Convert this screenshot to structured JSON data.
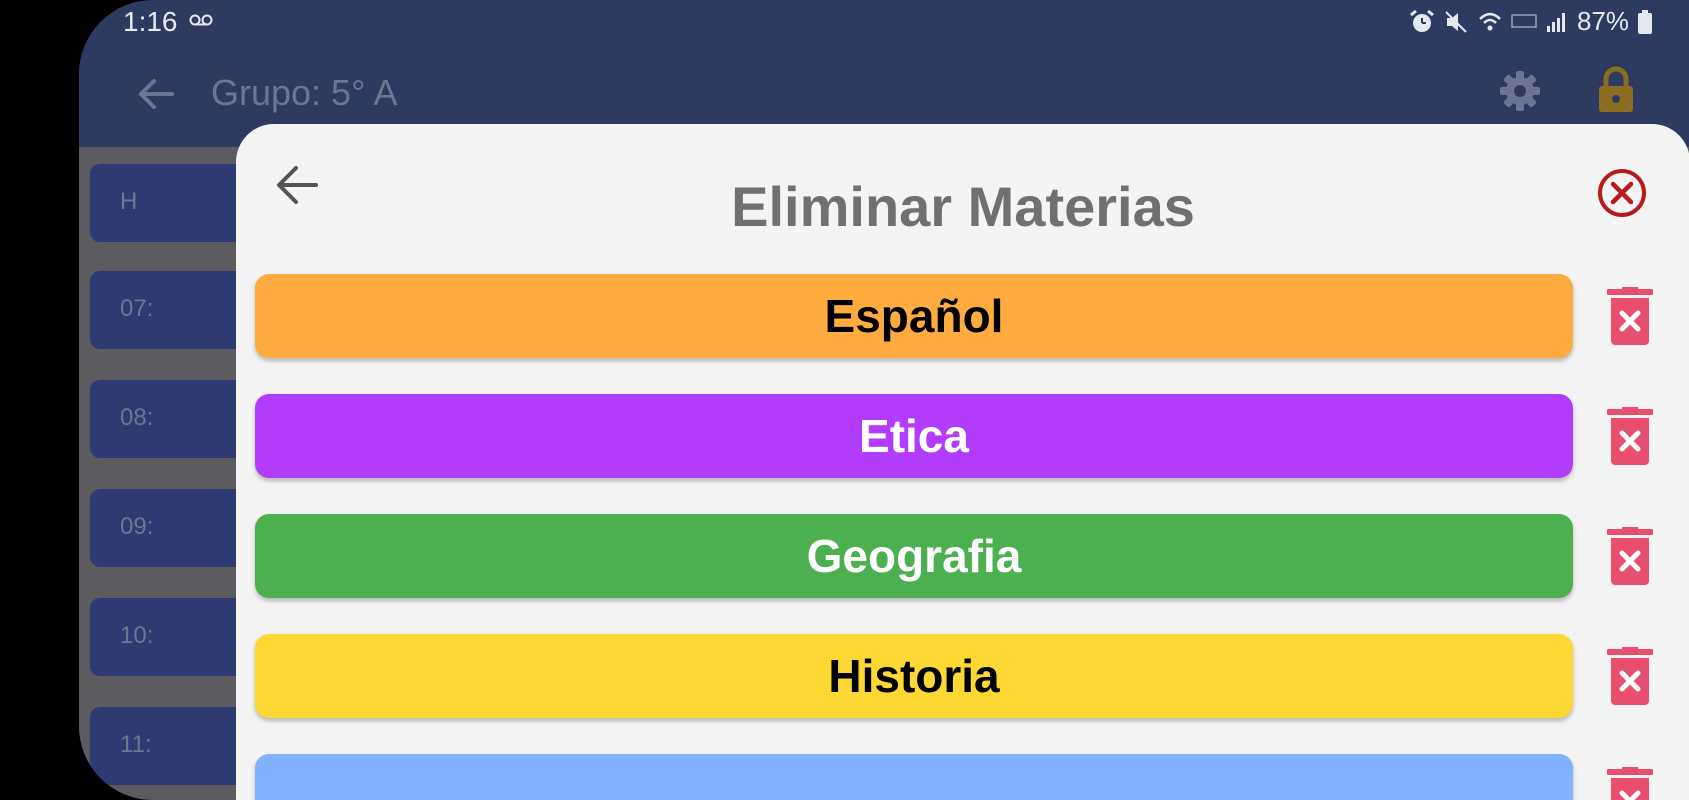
{
  "status": {
    "time": "1:16",
    "battery": "87%"
  },
  "appbar": {
    "title": "Grupo: 5° A"
  },
  "background_rows": [
    {
      "label": "H"
    },
    {
      "label": "07:"
    },
    {
      "label": "08:"
    },
    {
      "label": "09:"
    },
    {
      "label": "10:"
    },
    {
      "label": "11:"
    }
  ],
  "dialog": {
    "title": "Eliminar Materias",
    "subjects": [
      {
        "label": "Español",
        "color": "#ffab40",
        "text_color": "#000000"
      },
      {
        "label": "Etica",
        "color": "#b23cfb",
        "text_color": "#ffffff"
      },
      {
        "label": "Geografia",
        "color": "#4caf50",
        "text_color": "#ffffff"
      },
      {
        "label": "Historia",
        "color": "#fdd835",
        "text_color": "#000000"
      },
      {
        "label": "",
        "color": "#82b1ff",
        "text_color": "#000000"
      }
    ]
  },
  "colors": {
    "accent_red": "#b71c1c",
    "trash_pink": "#e84f6e",
    "appbar": "#2f3a60",
    "lock_gold": "#8a6d1f"
  }
}
